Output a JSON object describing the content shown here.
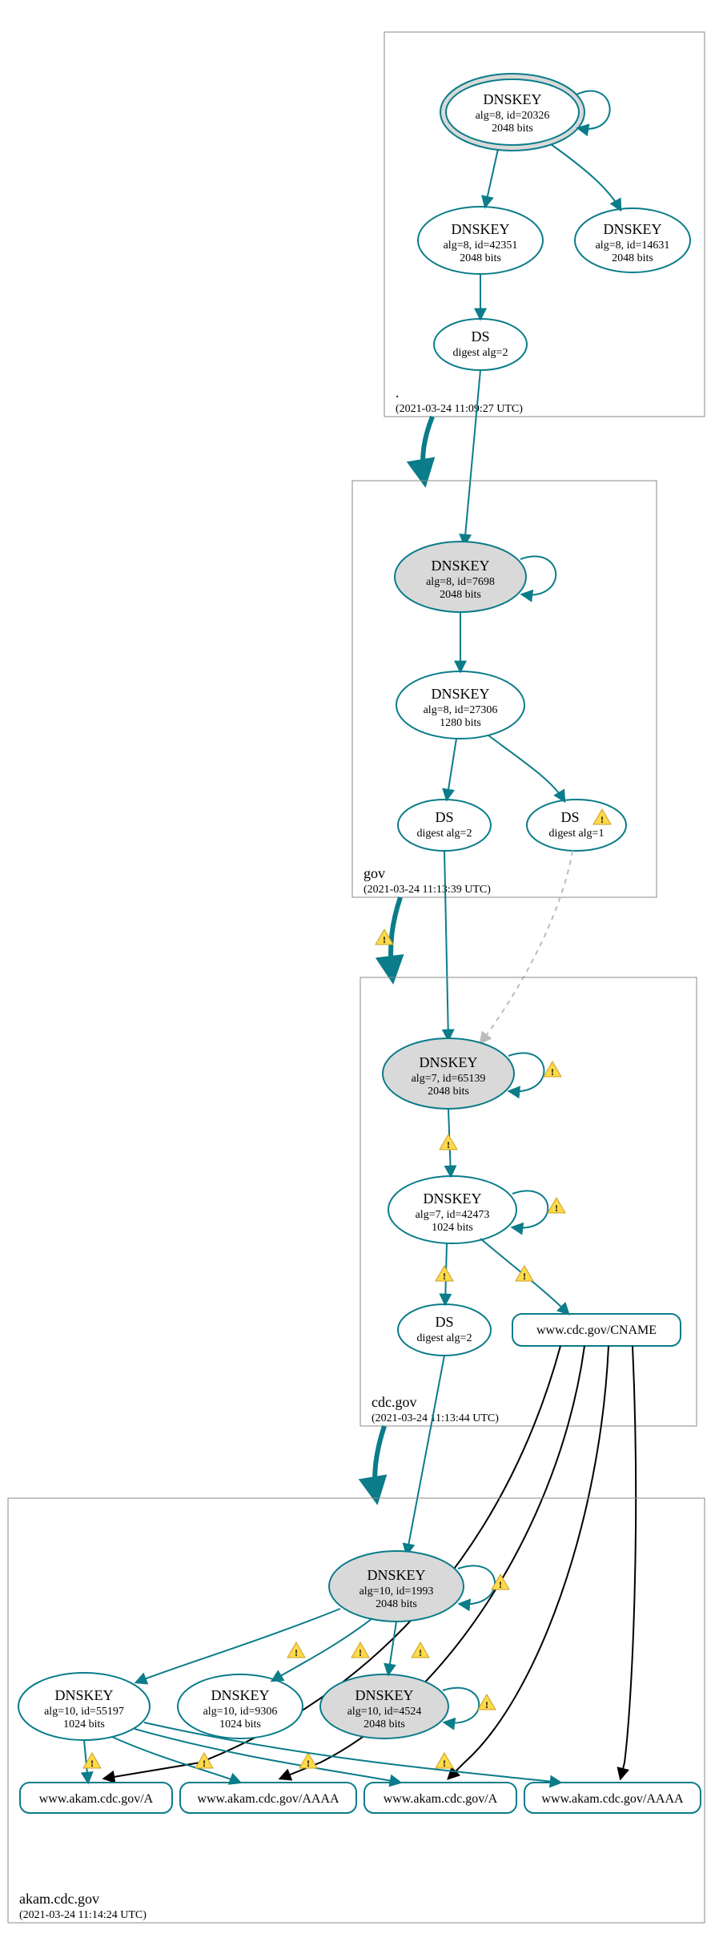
{
  "zones": {
    "root": {
      "label": ".",
      "time": "(2021-03-24 11:09:27 UTC)"
    },
    "gov": {
      "label": "gov",
      "time": "(2021-03-24 11:13:39 UTC)"
    },
    "cdc": {
      "label": "cdc.gov",
      "time": "(2021-03-24 11:13:44 UTC)"
    },
    "akam": {
      "label": "akam.cdc.gov",
      "time": "(2021-03-24 11:14:24 UTC)"
    }
  },
  "nodes": {
    "root_ksk": {
      "title": "DNSKEY",
      "sub1": "alg=8, id=20326",
      "sub2": "2048 bits"
    },
    "root_zsk": {
      "title": "DNSKEY",
      "sub1": "alg=8, id=42351",
      "sub2": "2048 bits"
    },
    "root_extra": {
      "title": "DNSKEY",
      "sub1": "alg=8, id=14631",
      "sub2": "2048 bits"
    },
    "root_ds": {
      "title": "DS",
      "sub1": "digest alg=2"
    },
    "gov_ksk": {
      "title": "DNSKEY",
      "sub1": "alg=8, id=7698",
      "sub2": "2048 bits"
    },
    "gov_zsk": {
      "title": "DNSKEY",
      "sub1": "alg=8, id=27306",
      "sub2": "1280 bits"
    },
    "gov_ds2": {
      "title": "DS",
      "sub1": "digest alg=2"
    },
    "gov_ds1": {
      "title": "DS",
      "sub1": "digest alg=1"
    },
    "cdc_ksk": {
      "title": "DNSKEY",
      "sub1": "alg=7, id=65139",
      "sub2": "2048 bits"
    },
    "cdc_zsk": {
      "title": "DNSKEY",
      "sub1": "alg=7, id=42473",
      "sub2": "1024 bits"
    },
    "cdc_ds": {
      "title": "DS",
      "sub1": "digest alg=2"
    },
    "cdc_cname": {
      "label": "www.cdc.gov/CNAME"
    },
    "akam_ksk": {
      "title": "DNSKEY",
      "sub1": "alg=10, id=1993",
      "sub2": "2048 bits"
    },
    "akam_k1": {
      "title": "DNSKEY",
      "sub1": "alg=10, id=55197",
      "sub2": "1024 bits"
    },
    "akam_k2": {
      "title": "DNSKEY",
      "sub1": "alg=10, id=9306",
      "sub2": "1024 bits"
    },
    "akam_k3": {
      "title": "DNSKEY",
      "sub1": "alg=10, id=4524",
      "sub2": "2048 bits"
    },
    "rec_a1": {
      "label": "www.akam.cdc.gov/A"
    },
    "rec_aaaa1": {
      "label": "www.akam.cdc.gov/AAAA"
    },
    "rec_a2": {
      "label": "www.akam.cdc.gov/A"
    },
    "rec_aaaa2": {
      "label": "www.akam.cdc.gov/AAAA"
    }
  }
}
